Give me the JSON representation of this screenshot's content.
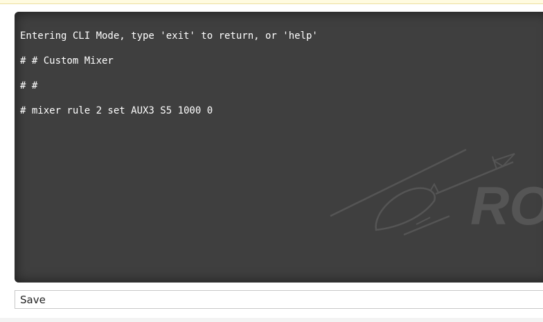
{
  "console": {
    "lines": [
      "Entering CLI Mode, type 'exit' to return, or 'help'",
      "# # Custom Mixer",
      "# #",
      "# mixer rule 2 set AUX3 S5 1000 0"
    ],
    "watermark_text": "ROT"
  },
  "cli_input": {
    "value": "Save"
  },
  "icons": {
    "watermark": "helicopter-logo-icon"
  },
  "colors": {
    "console_bg": "#3f3f3f",
    "console_text": "#ffffff",
    "watermark": "#555555"
  }
}
